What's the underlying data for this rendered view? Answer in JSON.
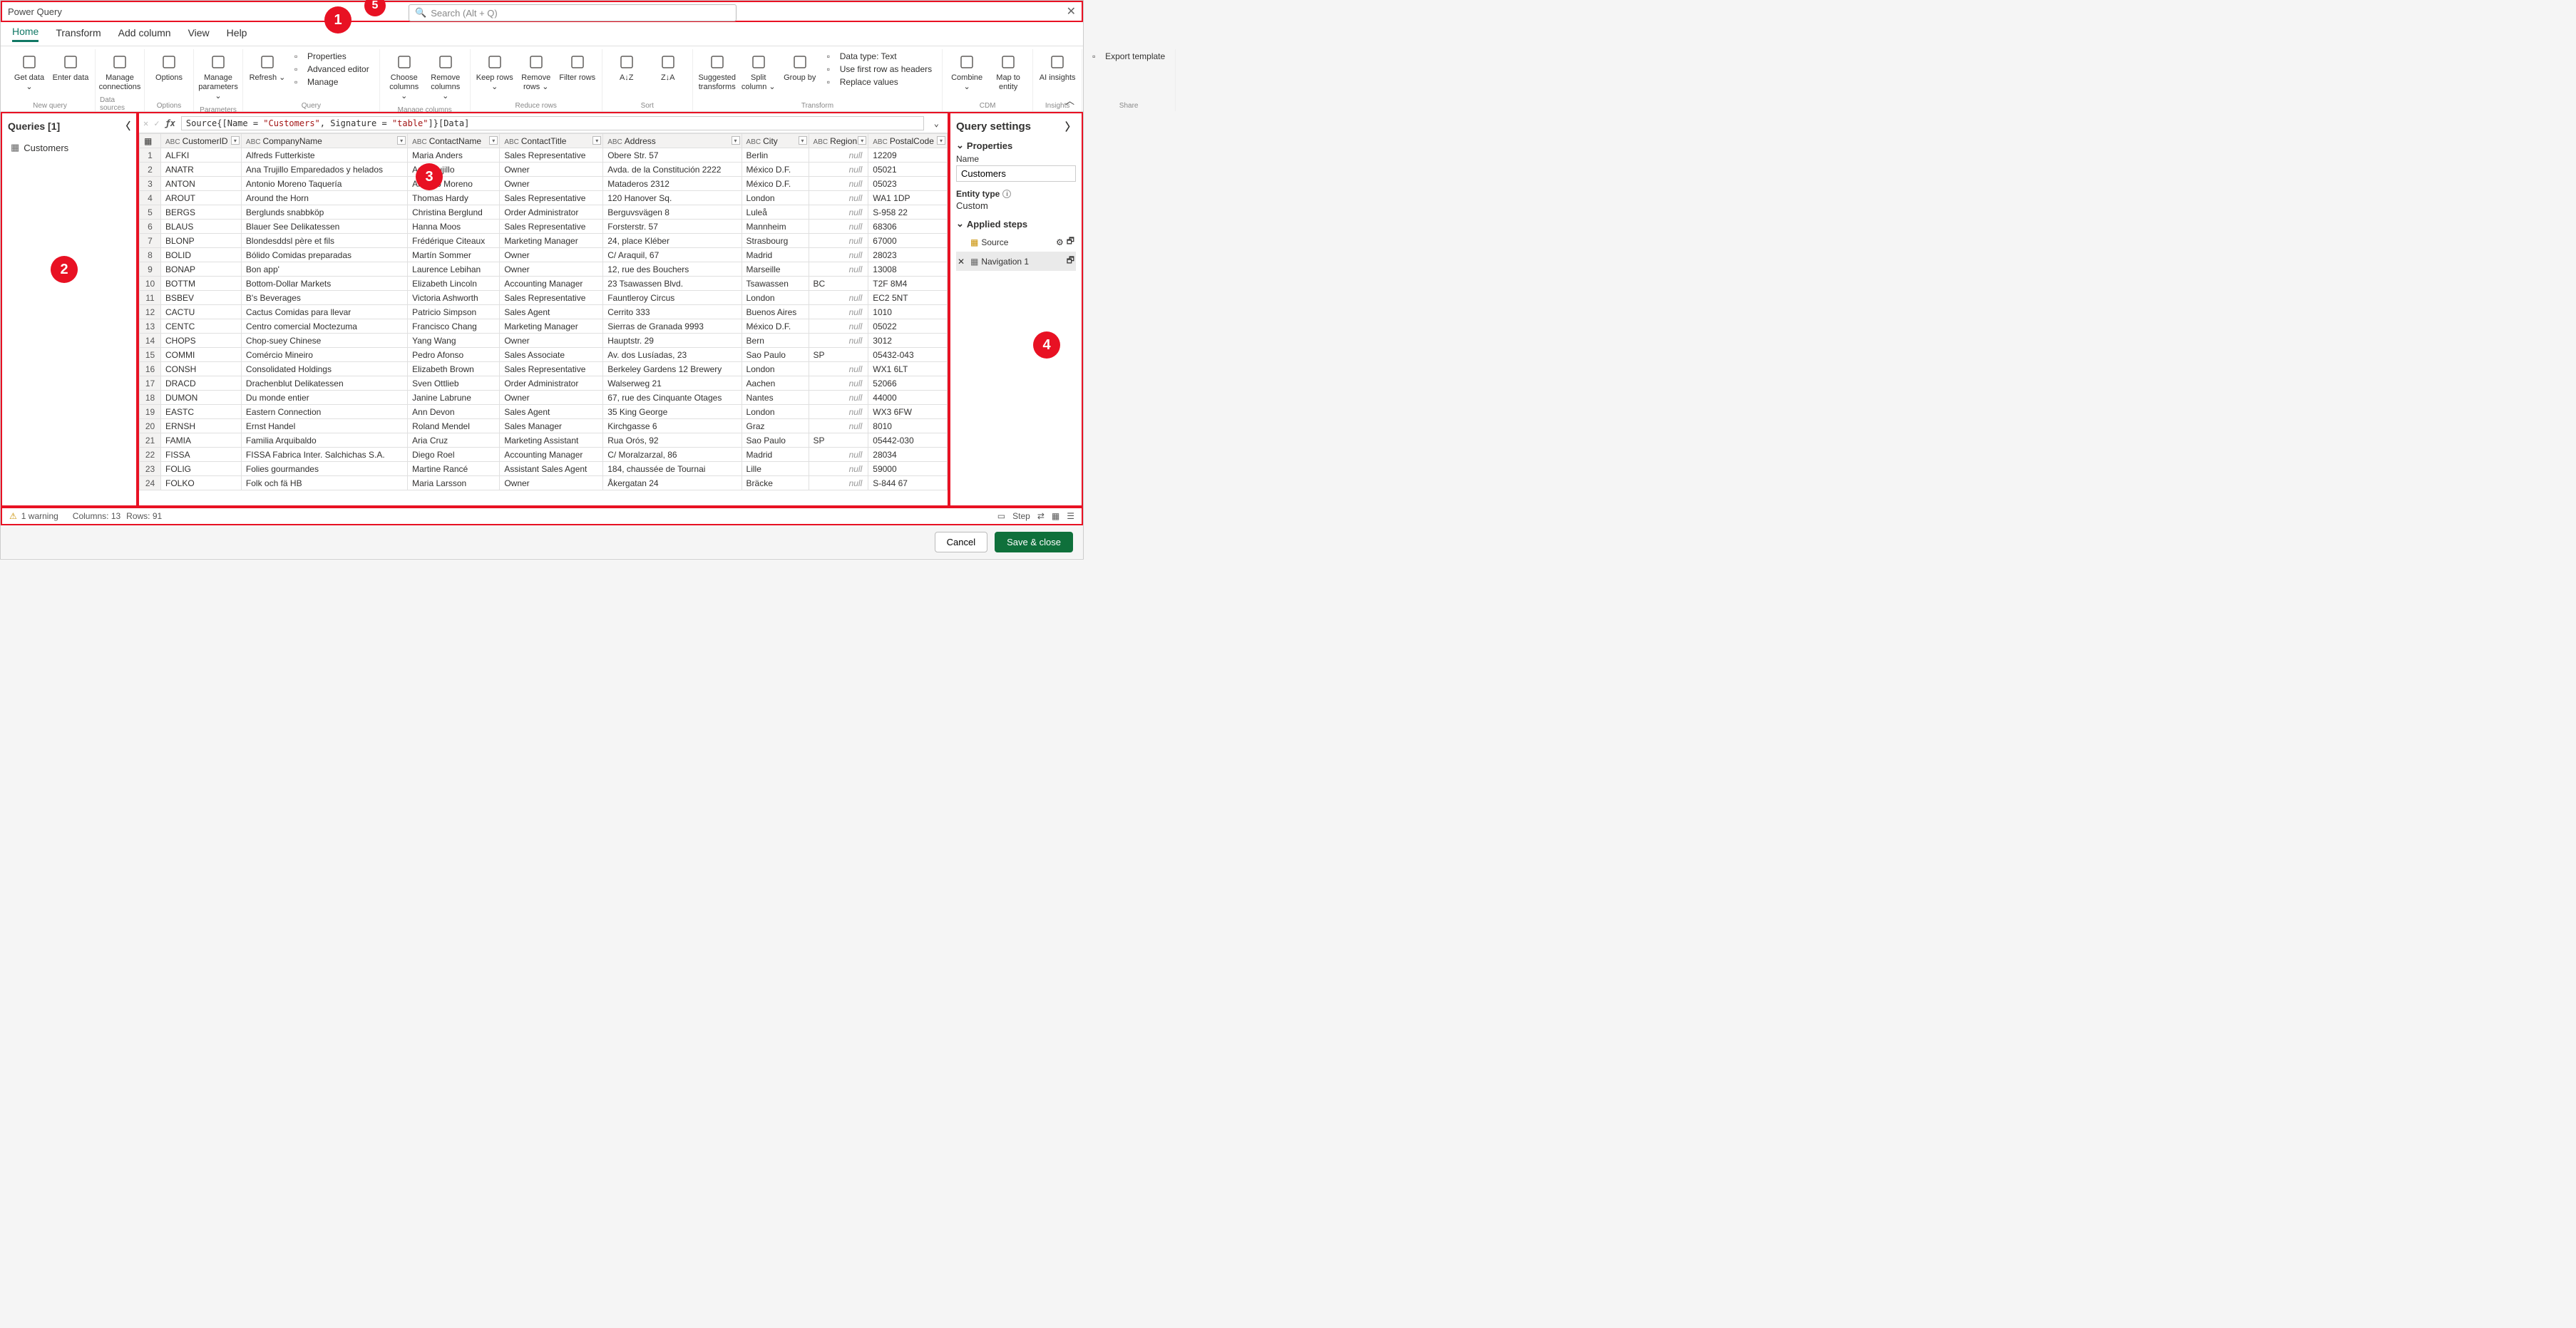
{
  "app": {
    "title": "Power Query",
    "search_placeholder": "Search (Alt + Q)"
  },
  "tabs": [
    "Home",
    "Transform",
    "Add column",
    "View",
    "Help"
  ],
  "ribbon": {
    "groups": [
      {
        "label": "New query",
        "buttons": [
          {
            "name": "get-data",
            "label": "Get data",
            "caret": true
          },
          {
            "name": "enter-data",
            "label": "Enter data"
          }
        ]
      },
      {
        "label": "Data sources",
        "buttons": [
          {
            "name": "manage-connections",
            "label": "Manage connections"
          }
        ]
      },
      {
        "label": "Options",
        "buttons": [
          {
            "name": "options",
            "label": "Options"
          }
        ]
      },
      {
        "label": "Parameters",
        "buttons": [
          {
            "name": "manage-parameters",
            "label": "Manage parameters",
            "caret": true
          }
        ]
      },
      {
        "label": "Query",
        "buttons": [
          {
            "name": "refresh",
            "label": "Refresh",
            "caret": true
          }
        ],
        "stacked": [
          "Properties",
          "Advanced editor",
          "Manage"
        ]
      },
      {
        "label": "Manage columns",
        "buttons": [
          {
            "name": "choose-columns",
            "label": "Choose columns",
            "caret": true
          },
          {
            "name": "remove-columns",
            "label": "Remove columns",
            "caret": true
          }
        ]
      },
      {
        "label": "Reduce rows",
        "buttons": [
          {
            "name": "keep-rows",
            "label": "Keep rows",
            "caret": true
          },
          {
            "name": "remove-rows",
            "label": "Remove rows",
            "caret": true
          },
          {
            "name": "filter-rows",
            "label": "Filter rows"
          }
        ]
      },
      {
        "label": "Sort",
        "buttons": [
          {
            "name": "sort-asc",
            "label": "A↓Z"
          },
          {
            "name": "sort-desc",
            "label": "Z↓A"
          }
        ]
      },
      {
        "label": "Transform",
        "buttons": [
          {
            "name": "suggested-transforms",
            "label": "Suggested transforms"
          },
          {
            "name": "split-column",
            "label": "Split column",
            "caret": true
          },
          {
            "name": "group-by",
            "label": "Group by"
          }
        ],
        "stacked": [
          "Data type: Text",
          "Use first row as headers",
          "Replace values"
        ]
      },
      {
        "label": "CDM",
        "buttons": [
          {
            "name": "combine",
            "label": "Combine",
            "caret": true
          },
          {
            "name": "map-to-entity",
            "label": "Map to entity"
          }
        ]
      },
      {
        "label": "Insights",
        "buttons": [
          {
            "name": "ai-insights",
            "label": "AI insights"
          }
        ]
      },
      {
        "label": "Share",
        "buttons": [],
        "stacked": [
          "Export template"
        ]
      }
    ]
  },
  "queries": {
    "header": "Queries [1]",
    "items": [
      "Customers"
    ]
  },
  "formula": {
    "text_pre": "Source{[Name = ",
    "str1": "\"Customers\"",
    "text_mid": ", Signature = ",
    "str2": "\"table\"",
    "text_post": "]}[Data]"
  },
  "columns": [
    "CustomerID",
    "CompanyName",
    "ContactName",
    "ContactTitle",
    "Address",
    "City",
    "Region",
    "PostalCode"
  ],
  "rows": [
    [
      "ALFKI",
      "Alfreds Futterkiste",
      "Maria Anders",
      "Sales Representative",
      "Obere Str. 57",
      "Berlin",
      null,
      "12209"
    ],
    [
      "ANATR",
      "Ana Trujillo Emparedados y helados",
      "Ana Trujillo",
      "Owner",
      "Avda. de la Constitución 2222",
      "México D.F.",
      null,
      "05021"
    ],
    [
      "ANTON",
      "Antonio Moreno Taquería",
      "Antonio Moreno",
      "Owner",
      "Mataderos  2312",
      "México D.F.",
      null,
      "05023"
    ],
    [
      "AROUT",
      "Around the Horn",
      "Thomas Hardy",
      "Sales Representative",
      "120 Hanover Sq.",
      "London",
      null,
      "WA1 1DP"
    ],
    [
      "BERGS",
      "Berglunds snabbköp",
      "Christina Berglund",
      "Order Administrator",
      "Berguvsvägen  8",
      "Luleå",
      null,
      "S-958 22"
    ],
    [
      "BLAUS",
      "Blauer See Delikatessen",
      "Hanna Moos",
      "Sales Representative",
      "Forsterstr. 57",
      "Mannheim",
      null,
      "68306"
    ],
    [
      "BLONP",
      "Blondesddsl père et fils",
      "Frédérique Citeaux",
      "Marketing Manager",
      "24, place Kléber",
      "Strasbourg",
      null,
      "67000"
    ],
    [
      "BOLID",
      "Bólido Comidas preparadas",
      "Martín Sommer",
      "Owner",
      "C/ Araquil, 67",
      "Madrid",
      null,
      "28023"
    ],
    [
      "BONAP",
      "Bon app'",
      "Laurence Lebihan",
      "Owner",
      "12, rue des Bouchers",
      "Marseille",
      null,
      "13008"
    ],
    [
      "BOTTM",
      "Bottom-Dollar Markets",
      "Elizabeth Lincoln",
      "Accounting Manager",
      "23 Tsawassen Blvd.",
      "Tsawassen",
      "BC",
      "T2F 8M4"
    ],
    [
      "BSBEV",
      "B's Beverages",
      "Victoria Ashworth",
      "Sales Representative",
      "Fauntleroy Circus",
      "London",
      null,
      "EC2 5NT"
    ],
    [
      "CACTU",
      "Cactus Comidas para llevar",
      "Patricio Simpson",
      "Sales Agent",
      "Cerrito 333",
      "Buenos Aires",
      null,
      "1010"
    ],
    [
      "CENTC",
      "Centro comercial Moctezuma",
      "Francisco Chang",
      "Marketing Manager",
      "Sierras de Granada 9993",
      "México D.F.",
      null,
      "05022"
    ],
    [
      "CHOPS",
      "Chop-suey Chinese",
      "Yang Wang",
      "Owner",
      "Hauptstr. 29",
      "Bern",
      null,
      "3012"
    ],
    [
      "COMMI",
      "Comércio Mineiro",
      "Pedro Afonso",
      "Sales Associate",
      "Av. dos Lusíadas, 23",
      "Sao Paulo",
      "SP",
      "05432-043"
    ],
    [
      "CONSH",
      "Consolidated Holdings",
      "Elizabeth Brown",
      "Sales Representative",
      "Berkeley Gardens 12  Brewery",
      "London",
      null,
      "WX1 6LT"
    ],
    [
      "DRACD",
      "Drachenblut Delikatessen",
      "Sven Ottlieb",
      "Order Administrator",
      "Walserweg 21",
      "Aachen",
      null,
      "52066"
    ],
    [
      "DUMON",
      "Du monde entier",
      "Janine Labrune",
      "Owner",
      "67, rue des Cinquante Otages",
      "Nantes",
      null,
      "44000"
    ],
    [
      "EASTC",
      "Eastern Connection",
      "Ann Devon",
      "Sales Agent",
      "35 King George",
      "London",
      null,
      "WX3 6FW"
    ],
    [
      "ERNSH",
      "Ernst Handel",
      "Roland Mendel",
      "Sales Manager",
      "Kirchgasse 6",
      "Graz",
      null,
      "8010"
    ],
    [
      "FAMIA",
      "Familia Arquibaldo",
      "Aria Cruz",
      "Marketing Assistant",
      "Rua Orós, 92",
      "Sao Paulo",
      "SP",
      "05442-030"
    ],
    [
      "FISSA",
      "FISSA Fabrica Inter. Salchichas S.A.",
      "Diego Roel",
      "Accounting Manager",
      "C/ Moralzarzal, 86",
      "Madrid",
      null,
      "28034"
    ],
    [
      "FOLIG",
      "Folies gourmandes",
      "Martine Rancé",
      "Assistant Sales Agent",
      "184, chaussée de Tournai",
      "Lille",
      null,
      "59000"
    ],
    [
      "FOLKO",
      "Folk och fä HB",
      "Maria Larsson",
      "Owner",
      "Åkergatan 24",
      "Bräcke",
      null,
      "S-844 67"
    ]
  ],
  "settings": {
    "header": "Query settings",
    "properties_label": "Properties",
    "name_label": "Name",
    "name_value": "Customers",
    "entity_type_label": "Entity type",
    "entity_type_value": "Custom",
    "applied_steps_label": "Applied steps",
    "steps": [
      "Source",
      "Navigation 1"
    ]
  },
  "status": {
    "warning": "1 warning",
    "columns": "Columns: 13",
    "rows": "Rows: 91",
    "step": "Step"
  },
  "buttons": {
    "cancel": "Cancel",
    "save": "Save & close"
  },
  "callouts": {
    "1": "1",
    "2": "2",
    "3": "3",
    "4": "4",
    "5": "5"
  }
}
